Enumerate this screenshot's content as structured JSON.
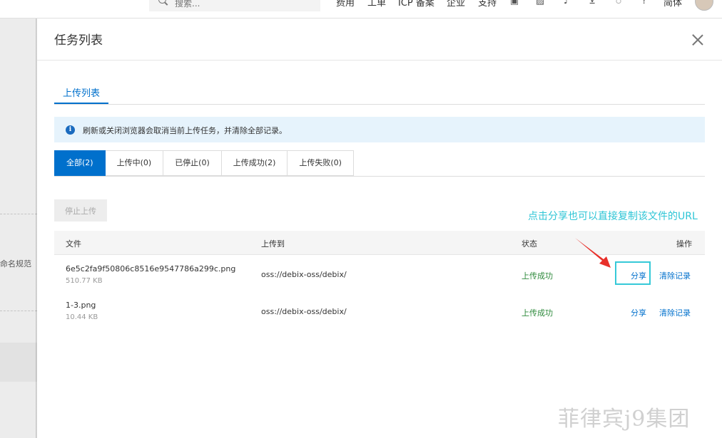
{
  "topbar": {
    "search_placeholder": "搜索...",
    "nav": [
      "费用",
      "工单",
      "ICP 备案",
      "企业",
      "支持"
    ],
    "icons": [
      "qr-code-icon",
      "image-icon",
      "bell-icon",
      "cart-icon",
      "bulb-icon",
      "help-icon"
    ],
    "language": "简体"
  },
  "background": {
    "left_label": "命名规范"
  },
  "panel": {
    "title": "任务列表",
    "tab": "上传列表",
    "notice": "刷新或关闭浏览器会取消当前上传任务，并清除全部记录。",
    "filters": [
      {
        "label": "全部(2)",
        "active": true
      },
      {
        "label": "上传中(0)",
        "active": false
      },
      {
        "label": "已停止(0)",
        "active": false
      },
      {
        "label": "上传成功(2)",
        "active": false
      },
      {
        "label": "上传失败(0)",
        "active": false
      }
    ],
    "stop_button": "停止上传",
    "table": {
      "headers": {
        "file": "文件",
        "dest": "上传到",
        "status": "状态",
        "ops": "操作"
      },
      "rows": [
        {
          "name": "6e5c2fa9f50806c8516e9547786a299c.png",
          "size": "510.77 KB",
          "dest": "oss://debix-oss/debix/",
          "status": "上传成功",
          "share": "分享",
          "clear": "清除记录"
        },
        {
          "name": "1-3.png",
          "size": "10.44 KB",
          "dest": "oss://debix-oss/debix/",
          "status": "上传成功",
          "share": "分享",
          "clear": "清除记录"
        }
      ]
    }
  },
  "annotation": {
    "text": "点击分享也可以直接复制该文件的URL",
    "color": "#2ec5d6",
    "arrow_color": "#e8302a"
  },
  "watermark": "菲律宾j9集团",
  "colors": {
    "accent": "#0070cc",
    "success": "#2e8a3c",
    "notice_bg": "#e6f3fc"
  }
}
